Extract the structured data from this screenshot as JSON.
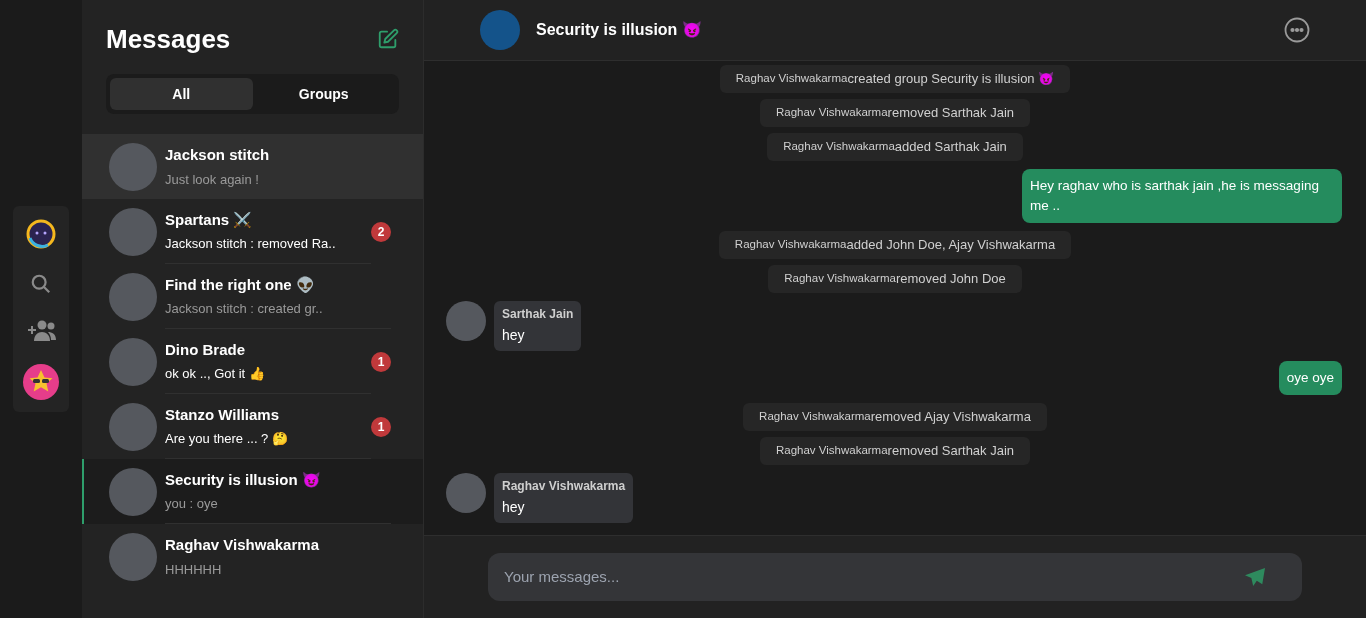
{
  "rail": {
    "items": [
      {
        "kind": "logo",
        "selected": false
      },
      {
        "kind": "search",
        "selected": false
      },
      {
        "kind": "add-people",
        "selected": false
      },
      {
        "kind": "profile",
        "selected": false
      }
    ]
  },
  "sidebar": {
    "title": "Messages",
    "tabs": [
      {
        "label": "All",
        "selected": true
      },
      {
        "label": "Groups",
        "selected": false
      }
    ],
    "conversations": [
      {
        "name": "Jackson stitch",
        "preview": "Just look again !",
        "unread": false,
        "highlighted": true,
        "selected": false
      },
      {
        "name": "Spartans ⚔️",
        "preview": "Jackson stitch : removed Ra..",
        "unread_count": "2",
        "unread": true,
        "highlighted": false,
        "selected": false
      },
      {
        "name": "Find the right one 👽",
        "preview": "Jackson stitch : created gr..",
        "unread": false,
        "highlighted": false,
        "selected": false
      },
      {
        "name": "Dino Brade",
        "preview": "ok ok .., Got it 👍",
        "unread_count": "1",
        "unread": true,
        "highlighted": false,
        "selected": false
      },
      {
        "name": "Stanzo Williams",
        "preview": "Are you there ... ? 🤔",
        "unread_count": "1",
        "unread": true,
        "highlighted": false,
        "selected": false
      },
      {
        "name": "Security is illusion 😈",
        "preview": "you : oye",
        "unread": false,
        "highlighted": false,
        "selected": true
      },
      {
        "name": "Raghav Vishwakarma",
        "preview": "HHHHHH",
        "unread": false,
        "highlighted": false,
        "selected": false
      }
    ]
  },
  "chat": {
    "title": "Security is illusion 😈",
    "messages": [
      {
        "kind": "system",
        "actor": "Raghav Vishwakarma",
        "text": "created group Security is illusion 😈"
      },
      {
        "kind": "system",
        "actor": "Raghav Vishwakarma",
        "text": "removed Sarthak Jain"
      },
      {
        "kind": "system",
        "actor": "Raghav Vishwakarma",
        "text": "added Sarthak Jain"
      },
      {
        "kind": "outgoing",
        "text": "Hey raghav who is sarthak jain ,he is messaging me .."
      },
      {
        "kind": "system",
        "actor": "Raghav Vishwakarma",
        "text": "added John Doe, Ajay Vishwakarma"
      },
      {
        "kind": "system",
        "actor": "Raghav Vishwakarma",
        "text": "removed John Doe"
      },
      {
        "kind": "incoming",
        "sender": "Sarthak Jain",
        "text": "hey"
      },
      {
        "kind": "outgoing",
        "text": "oye oye"
      },
      {
        "kind": "system",
        "actor": "Raghav Vishwakarma",
        "text": "removed Ajay Vishwakarma"
      },
      {
        "kind": "system",
        "actor": "Raghav Vishwakarma",
        "text": "removed Sarthak Jain"
      },
      {
        "kind": "incoming",
        "sender": "Raghav Vishwakarma",
        "text": "hey"
      }
    ],
    "composer": {
      "placeholder": "Your messages..."
    }
  }
}
